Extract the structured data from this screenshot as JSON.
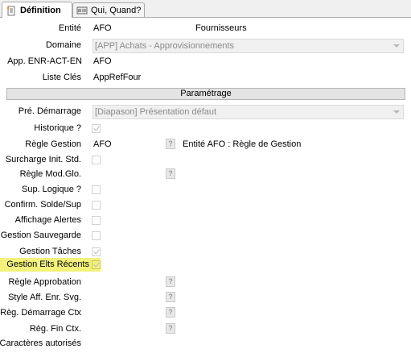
{
  "tabs": [
    {
      "label": "Définition",
      "active": true,
      "icon": "document-icon"
    },
    {
      "label": "Qui, Quand?",
      "active": false,
      "icon": "id-card-icon"
    }
  ],
  "top": {
    "entite_label": "Entité",
    "entite_value": "AFO",
    "entite_desc": "Fournisseurs",
    "domaine_label": "Domaine",
    "domaine_value": "[APP] Achats - Approvisionnements",
    "app_label": "App. ENR-ACT-EN",
    "app_value": "AFO",
    "cles_label": "Liste Clés",
    "cles_value": "AppRefFour"
  },
  "section_title": "Paramétrage",
  "params": {
    "demarrage_label": "Pré. Démarrage",
    "demarrage_value": "[Diapason] Présentation défaut",
    "historique_label": "Historique ?",
    "regle_gestion_label": "Règle Gestion",
    "regle_gestion_value": "AFO",
    "regle_gestion_desc": "Entité AFO : Règle de Gestion",
    "surcharge_label": "Surcharge Init. Std.",
    "regle_mod_label": "Règle Mod.Glo.",
    "sup_logique_label": "Sup. Logique ?",
    "confirm_label": "Confirm. Solde/Sup",
    "affichage_label": "Affichage Alertes",
    "sauvegarde_label": "Gestion Sauvegarde",
    "taches_label": "Gestion Tâches",
    "elts_label": "Gestion Elts Récents",
    "approbation_label": "Règle Approbation",
    "style_label": "Style Aff. Enr. Svg.",
    "reg_dem_label": "Règ. Démarrage Ctx",
    "reg_fin_label": "Règ. Fin Ctx.",
    "caracteres_label": "Caractères autorisés"
  },
  "help_glyph": "?",
  "colors": {
    "highlight": "#f2f27a",
    "disabled_text": "#8a8a8a"
  }
}
